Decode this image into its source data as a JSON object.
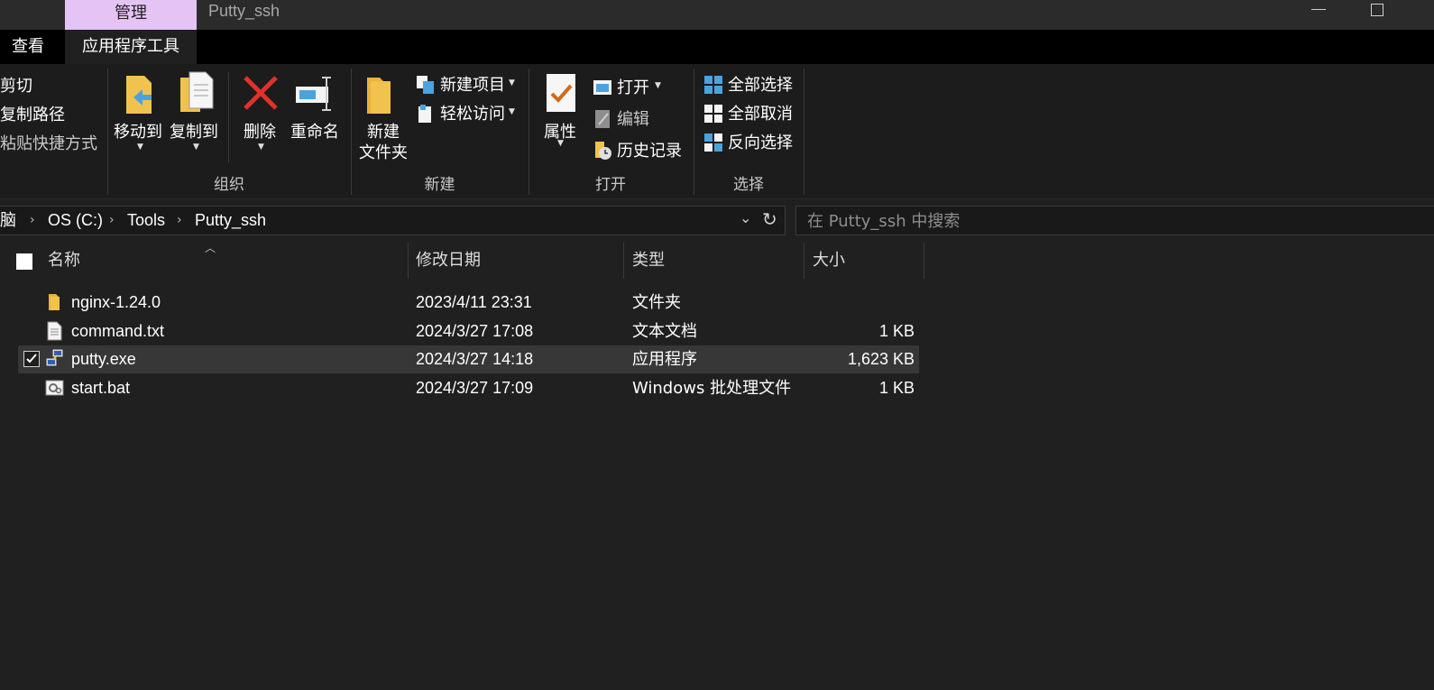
{
  "window": {
    "title": "Putty_ssh",
    "context_tab": "管理"
  },
  "tabs": {
    "view": "查看",
    "app_tools": "应用程序工具"
  },
  "ribbon": {
    "clipboard": {
      "cut": "剪切",
      "copy_path": "复制路径",
      "paste_shortcut": "粘贴快捷方式"
    },
    "organize": {
      "label": "组织",
      "move_to": "移动到",
      "copy_to": "复制到",
      "delete": "删除",
      "rename": "重命名"
    },
    "new": {
      "label": "新建",
      "new_folder_line1": "新建",
      "new_folder_line2": "文件夹",
      "new_item": "新建项目",
      "easy_access": "轻松访问"
    },
    "open": {
      "label": "打开",
      "properties": "属性",
      "open": "打开",
      "edit": "编辑",
      "history": "历史记录"
    },
    "select": {
      "label": "选择",
      "select_all": "全部选择",
      "select_none": "全部取消",
      "invert": "反向选择"
    }
  },
  "address": {
    "crumbs": [
      "电脑",
      "OS (C:)",
      "Tools",
      "Putty_ssh"
    ],
    "crumb_prefix_visible": "脑"
  },
  "search": {
    "placeholder": "在 Putty_ssh 中搜索"
  },
  "columns": {
    "name": "名称",
    "modified": "修改日期",
    "type": "类型",
    "size": "大小"
  },
  "files": [
    {
      "name": "nginx-1.24.0",
      "modified": "2023/4/11 23:31",
      "type": "文件夹",
      "size": "",
      "icon": "folder-icon",
      "selected": false
    },
    {
      "name": "command.txt",
      "modified": "2024/3/27 17:08",
      "type": "文本文档",
      "size": "1 KB",
      "icon": "text-file-icon",
      "selected": false
    },
    {
      "name": "putty.exe",
      "modified": "2024/3/27 14:18",
      "type": "应用程序",
      "size": "1,623 KB",
      "icon": "putty-app-icon",
      "selected": true
    },
    {
      "name": "start.bat",
      "modified": "2024/3/27 17:09",
      "type": "Windows 批处理文件",
      "size": "1 KB",
      "icon": "batch-file-icon",
      "selected": false
    }
  ],
  "colors": {
    "background": "#202020",
    "context_tab": "#e5c4f5",
    "selected_row": "#373737",
    "folder": "#f2c24e",
    "delete_red": "#e0312b",
    "accent_blue": "#4aa3df"
  }
}
